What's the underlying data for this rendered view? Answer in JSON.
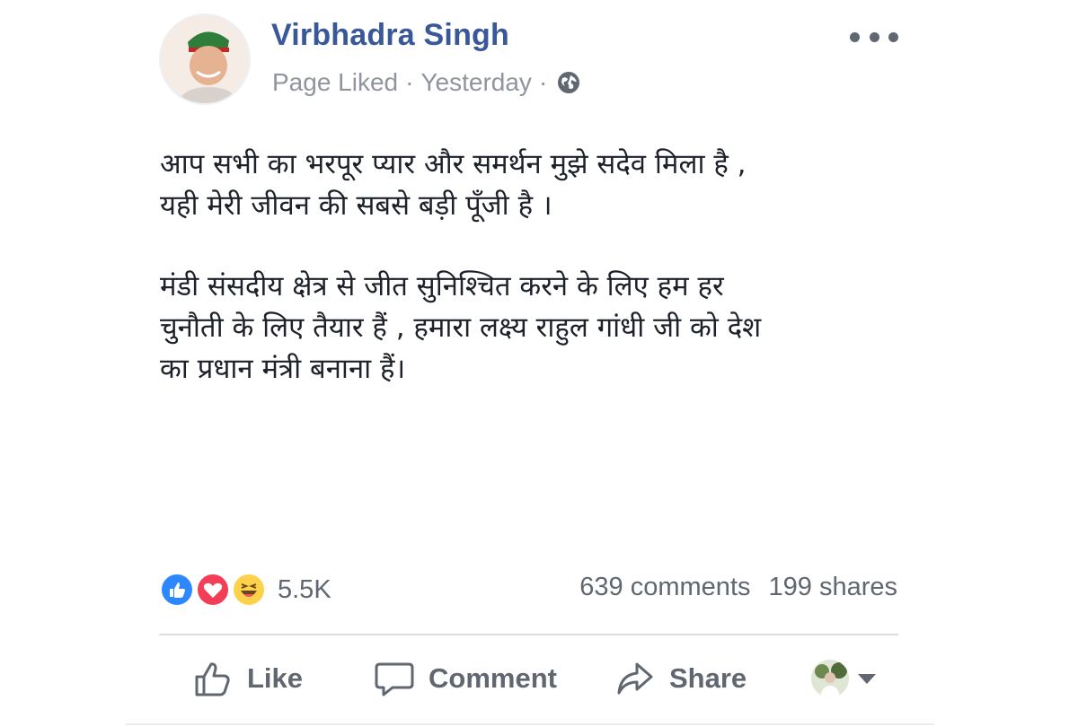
{
  "post": {
    "author": "Virbhadra Singh",
    "meta_status": "Page Liked",
    "meta_separator": "·",
    "meta_time": "Yesterday",
    "meta_audience_icon": "globe-icon",
    "more_icon": "more-options-icon",
    "paragraphs": [
      "आप सभी का भरपूर प्यार और समर्थन मुझे सदेव मिला है ,\nयही मेरी जीवन की सबसे बड़ी पूँजी है ।",
      "मंडी संसदीय क्षेत्र से जीत सुनिश्चित करने के लिए हम हर\nचुनौती के लिए तैयार हैं , हमारा लक्ष्य राहुल गांधी जी को देश\nका प्रधान मंत्री बनाना हैं।"
    ]
  },
  "engagement": {
    "reaction_icons": [
      "like-reaction-icon",
      "love-reaction-icon",
      "haha-reaction-icon"
    ],
    "reaction_count": "5.5K",
    "comments": "639 comments",
    "shares": "199 shares"
  },
  "actions": {
    "like": "Like",
    "comment": "Comment",
    "share": "Share"
  },
  "colors": {
    "author": "#385898",
    "secondary_text": "#90949c",
    "action_text": "#606770",
    "like_reaction": "#2d88ff",
    "love_reaction": "#f33e58",
    "haha_reaction": "#fdd149"
  }
}
